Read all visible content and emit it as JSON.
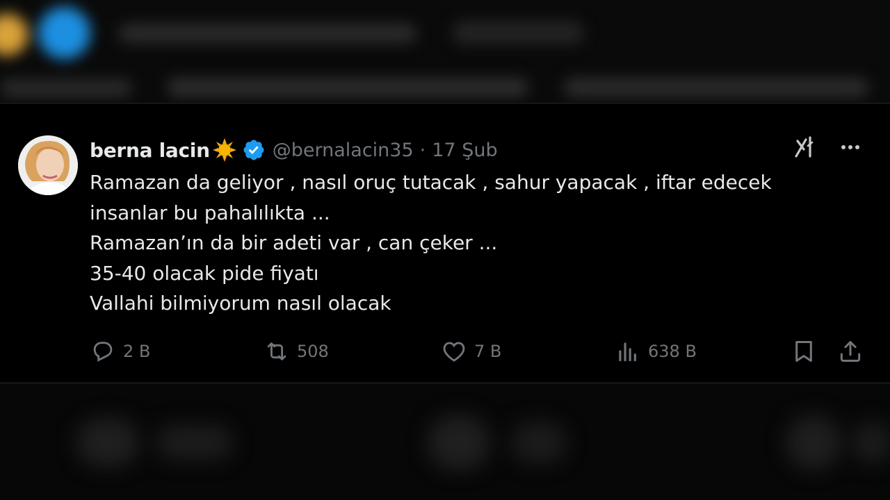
{
  "tweet": {
    "name": "berna lacin",
    "handle": "@bernalacin35",
    "separator": "·",
    "date": "17 Şub",
    "lines": [
      "Ramazan da geliyor , nasıl oruç tutacak , sahur yapacak , iftar edecek",
      "insanlar bu pahalılıkta ...",
      "Ramazan’ın da bir adeti var , can çeker ...",
      "35-40 olacak pide fiyatı",
      "Vallahi bilmiyorum nasıl olacak"
    ],
    "stats": {
      "replies": "2 B",
      "reposts": "508",
      "likes": "7 B",
      "views": "638 B"
    }
  },
  "icons": {
    "emoji": "sun-emoji-icon",
    "verified": "verified-badge-icon",
    "grok": "grok-icon",
    "more": "more-icon",
    "reply": "reply-icon",
    "repost": "repost-icon",
    "like": "like-icon",
    "views": "views-icon",
    "bookmark": "bookmark-icon",
    "share": "share-icon"
  },
  "colors": {
    "background": "#000000",
    "text": "#e7e9ea",
    "secondary": "#71767b",
    "verified": "#1d9bf0"
  }
}
